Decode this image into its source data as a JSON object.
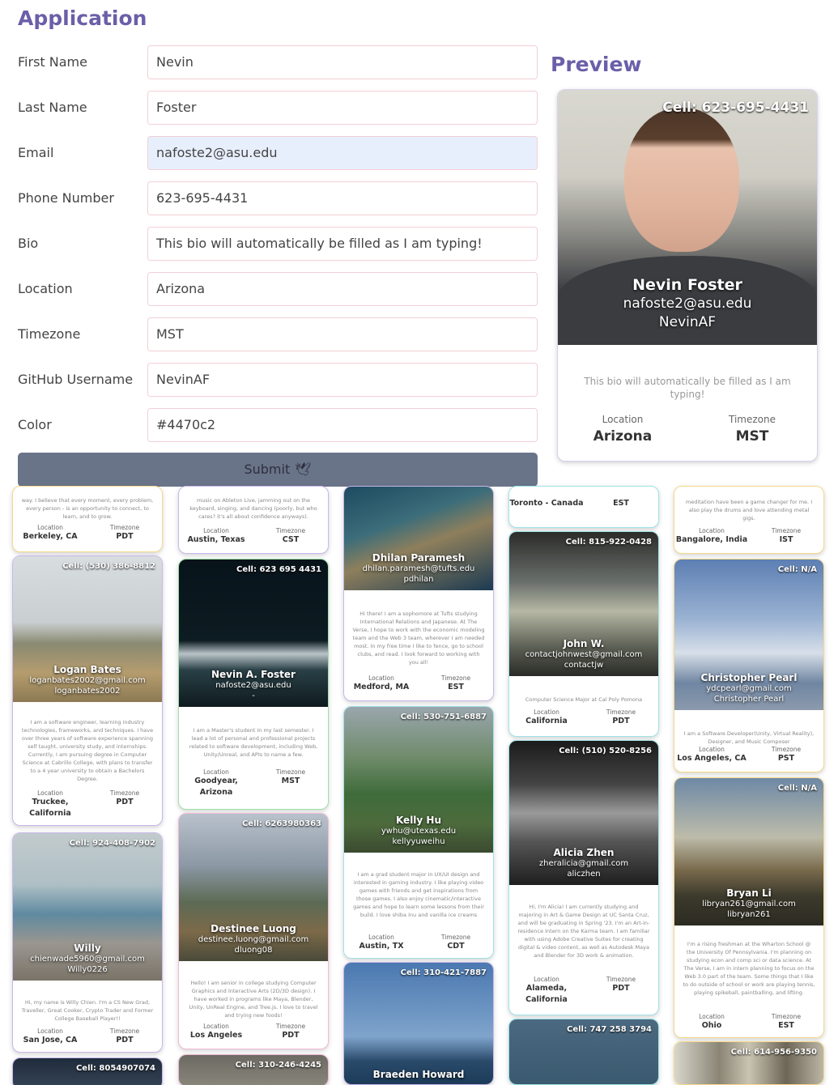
{
  "app_title": "Application",
  "preview_title": "Preview",
  "form": {
    "fields": [
      {
        "label": "First Name",
        "value": "Nevin"
      },
      {
        "label": "Last Name",
        "value": "Foster"
      },
      {
        "label": "Email",
        "value": "nafoste2@asu.edu"
      },
      {
        "label": "Phone Number",
        "value": "623-695-4431"
      },
      {
        "label": "Bio",
        "value": "This bio will automatically be filled as I am typing!"
      },
      {
        "label": "Location",
        "value": "Arizona"
      },
      {
        "label": "Timezone",
        "value": "MST"
      },
      {
        "label": "GitHub Username",
        "value": "NevinAF"
      },
      {
        "label": "Color",
        "value": "#4470c2"
      }
    ],
    "submit_label": "Submit",
    "submit_icon": "dove-icon"
  },
  "preview": {
    "cell": "Cell: 623-695-4431",
    "name": "Nevin Foster",
    "email": "nafoste2@asu.edu",
    "username": "NevinAF",
    "bio": "This bio will automatically be filled as I am typing!",
    "location_label": "Location",
    "location": "Arizona",
    "timezone_label": "Timezone",
    "timezone": "MST"
  },
  "gallery": {
    "location_label": "Location",
    "timezone_label": "Timezone",
    "cards": [
      {
        "bio": "way. I believe that every moment, every problem, every person - is an opportunity to connect, to learn, and to grow.",
        "location": "Berkeley, CA",
        "timezone": "PDT"
      },
      {
        "bio": "music on Ableton Live, jamming out on the keyboard, singing, and dancing (poorly, but who cares? it's all about confidence anyways).",
        "location": "Austin, Texas",
        "timezone": "CST"
      },
      {
        "name": "Dhilan Paramesh",
        "email": "dhilan.paramesh@tufts.edu",
        "username": "pdhilan",
        "bio": "Hi there! I am a sophomore at Tufts studying International Relations and Japanese. At The Verse, I hope to work with the economic modeling team and the Web 3 team, wherever I am needed most. In my free time I like to fence, go to school clubs, and read. I look forward to working with you all!",
        "location": "Medford, MA",
        "timezone": "EST"
      },
      {
        "location": "Toronto - Canada",
        "timezone": "EST"
      },
      {
        "bio": "meditation have been a game changer for me. I also play the drums and love attending metal gigs.",
        "location": "Bangalore, India",
        "timezone": "IST"
      },
      {
        "cell": "Cell: (530) 386-8812",
        "name": "Logan Bates",
        "email": "loganbates2002@gmail.com",
        "username": "loganbates2002",
        "bio": "I am a software engineer, learning industry technologies, frameworks, and techniques. I have over three years of software experience spanning self taught, university study, and internships. Currently, I am pursuing degree in Computer Science at Cabrillo College, with plans to transfer to a 4 year university to obtain a Bachelors Degree.",
        "location": "Truckee, California",
        "timezone": "PDT"
      },
      {
        "cell": "Cell: 623 695 4431",
        "name": "Nevin A. Foster",
        "email": "nafoste2@asu.edu",
        "username": "-",
        "bio": "I am a Master's student in my last semester. I lead a lot of personal and professional projects related to software development, including Web, Unity/Unreal, and APIs to name a few.",
        "location": "Goodyear, Arizona",
        "timezone": "MST"
      },
      {
        "cell": "Cell: 815-922-0428",
        "name": "John W.",
        "email": "contactjohnwest@gmail.com",
        "username": "contactjw",
        "bio": "Computer Science Major at Cal Poly Pomona",
        "location": "California",
        "timezone": "PDT"
      },
      {
        "cell": "Cell: N/A",
        "name": "Christopher Pearl",
        "email": "ydcpearl@gmail.com",
        "username": "Christopher Pearl",
        "bio": "I am a Software Developer(Unity, Virtual Reality), Designer, and Music Composer",
        "location": "Los Angeles, CA",
        "timezone": "PST"
      },
      {
        "cell": "Cell: 530-751-6887",
        "name": "Kelly Hu",
        "email": "ywhu@utexas.edu",
        "username": "kellyyuweihu",
        "bio": "I am a grad student major in UX/UI design and interested in gaming industry. I like playing video games with friends and get inspirations from those games. I also enjoy cinematic/interactive games and hope to learn some lessons from their build. I love shiba inu and vanilla ice creams",
        "location": "Austin, TX",
        "timezone": "CDT"
      },
      {
        "cell": "Cell: (510) 520-8256",
        "name": "Alicia Zhen",
        "email": "zheralicia@gmail.com",
        "username": "aliczhen",
        "bio": "Hi, I'm Alicia! I am currently studying and majoring in Art & Game Design at UC Santa Cruz, and will be graduating in Spring '23. I'm an Art-in-residence Intern on the Karma team. I am familiar with using Adobe Creative Suites for creating digital & video content, as well as Autodesk Maya and Blender for 3D work & animation.",
        "location": "Alameda, California",
        "timezone": "PDT"
      },
      {
        "cell": "Cell: 924-408-7902",
        "name": "Willy",
        "email": "chienwade5960@gmail.com",
        "username": "Willy0226",
        "bio": "Hi, my name is Willy Chien. I'm a CS New Grad, Traveller, Great Cooker, Crypto Trader and Former College Baseball Player!!",
        "location": "San Jose, CA",
        "timezone": "PDT"
      },
      {
        "cell": "Cell: 6263980363",
        "name": "Destinee Luong",
        "email": "destinee.luong@gmail.com",
        "username": "dluong08",
        "bio": "Hello! I am senior in college studying Computer Graphics and Interactive Arts (2D/3D design). I have worked in programs like Maya, Blender, Unity, UnReal Engine, and Tree.js. I love to travel and trying new foods!",
        "location": "Los Angeles",
        "timezone": "PDT"
      },
      {
        "cell": "Cell: N/A",
        "name": "Bryan Li",
        "email": "libryan261@gmail.com",
        "username": "libryan261",
        "bio": "I'm a rising freshman at the Wharton School @ the University Of Pennsylvania. I'm planning on studying econ and comp sci or data science. At The Verse, I am in intern planning to focus on the Web 3.0 part of the team. Some things that I like to do outside of school or work are playing tennis, playing spikeball, paintballing, and lifting.",
        "location": "Ohio",
        "timezone": "EST"
      },
      {
        "cell": "Cell: 8054907074"
      },
      {
        "cell": "Cell: 310-246-4245"
      },
      {
        "cell": "Cell: 310-421-7887",
        "name": "Braeden Howard"
      },
      {
        "cell": "Cell: 747 258 3794"
      },
      {
        "cell": "Cell: 614-956-9350"
      }
    ]
  },
  "colors": {
    "title": "#6a5fa8",
    "field_border": "#f3cfd5",
    "autofill_bg": "#e8effc",
    "submit_bg": "#6a7489",
    "card_border_yellow": "#f6d98a",
    "card_border_purple": "#c8b7ec",
    "card_border_green": "#9fe0a6",
    "card_border_cyan": "#9fe3e8",
    "card_border_pink": "#f0b9d4"
  }
}
